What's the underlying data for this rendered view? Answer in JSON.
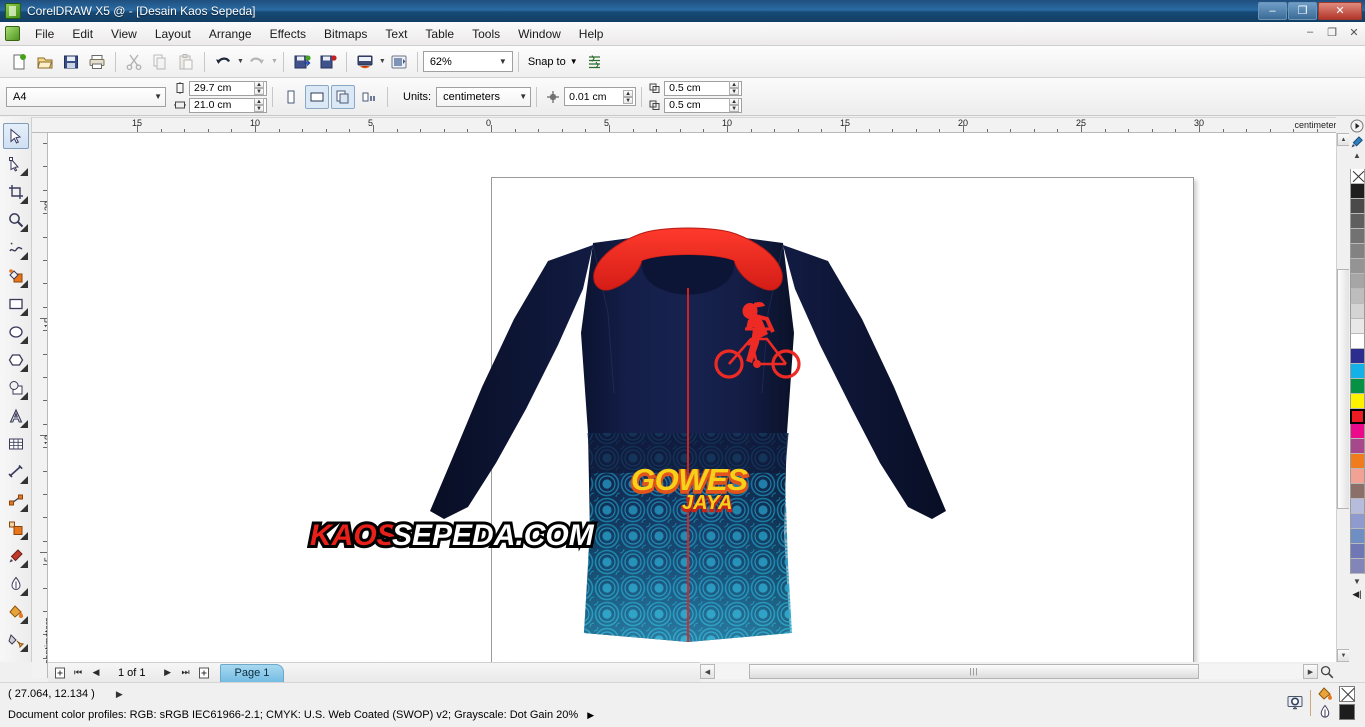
{
  "window": {
    "title": "CorelDRAW X5 @ - [Desain Kaos Sepeda]",
    "app_icon": "coreldraw-icon",
    "minimize": "–",
    "maximize": "❐",
    "close": "✕",
    "mdi_minimize": "–",
    "mdi_restore": "❐",
    "mdi_close": "✕"
  },
  "menubar": {
    "items": [
      {
        "label": "File",
        "accel": "F"
      },
      {
        "label": "Edit",
        "accel": "E"
      },
      {
        "label": "View",
        "accel": "V"
      },
      {
        "label": "Layout",
        "accel": "L"
      },
      {
        "label": "Arrange",
        "accel": "A"
      },
      {
        "label": "Effects",
        "accel": "c"
      },
      {
        "label": "Bitmaps",
        "accel": "B"
      },
      {
        "label": "Text",
        "accel": "x"
      },
      {
        "label": "Table",
        "accel": "T"
      },
      {
        "label": "Tools",
        "accel": "o"
      },
      {
        "label": "Window",
        "accel": "W"
      },
      {
        "label": "Help",
        "accel": "H"
      }
    ]
  },
  "toolbar": {
    "buttons": [
      {
        "name": "new-document-button",
        "tooltip": "New"
      },
      {
        "name": "open-document-button",
        "tooltip": "Open"
      },
      {
        "name": "save-document-button",
        "tooltip": "Save"
      },
      {
        "name": "print-button",
        "tooltip": "Print"
      },
      {
        "name": "cut-button",
        "tooltip": "Cut"
      },
      {
        "name": "copy-button",
        "tooltip": "Copy"
      },
      {
        "name": "paste-button",
        "tooltip": "Paste"
      },
      {
        "name": "undo-button",
        "tooltip": "Undo"
      },
      {
        "name": "redo-button",
        "tooltip": "Redo"
      },
      {
        "name": "import-button",
        "tooltip": "Import"
      },
      {
        "name": "export-button",
        "tooltip": "Export"
      },
      {
        "name": "publish-pdf-button",
        "tooltip": "Publish to PDF"
      },
      {
        "name": "application-launcher-button",
        "tooltip": "Application Launcher"
      }
    ],
    "zoom_level": "62%",
    "snap_to_label": "Snap to",
    "options_tooltip": "Options"
  },
  "propertybar": {
    "paper_type": "A4",
    "page_width": "29.7 cm",
    "page_height": "21.0 cm",
    "orientation_portrait": "portrait-icon",
    "orientation_landscape": "landscape-icon",
    "all_pages_icon": "all-pages-icon",
    "current_page_icon": "current-page-icon",
    "units_label": "Units:",
    "units_value": "centimeters",
    "nudge_offset": "0.01 cm",
    "duplicate_x": "0.5 cm",
    "duplicate_y": "0.5 cm"
  },
  "rulers": {
    "unit_label": "centimeters",
    "horizontal_ticks": [
      "15",
      "10",
      "5",
      "0",
      "5",
      "10",
      "15",
      "20",
      "25",
      "30"
    ],
    "vertical_ticks": [
      "20",
      "15",
      "10",
      "5"
    ]
  },
  "toolbox": {
    "tools": [
      {
        "name": "pick-tool",
        "selected": true
      },
      {
        "name": "shape-tool",
        "selected": false
      },
      {
        "name": "crop-tool",
        "selected": false
      },
      {
        "name": "zoom-tool",
        "selected": false
      },
      {
        "name": "freehand-tool",
        "selected": false
      },
      {
        "name": "smart-fill-tool",
        "selected": false
      },
      {
        "name": "rectangle-tool",
        "selected": false
      },
      {
        "name": "ellipse-tool",
        "selected": false
      },
      {
        "name": "polygon-tool",
        "selected": false
      },
      {
        "name": "basic-shapes-tool",
        "selected": false
      },
      {
        "name": "text-tool",
        "selected": false
      },
      {
        "name": "table-tool",
        "selected": false
      },
      {
        "name": "dimension-tool",
        "selected": false
      },
      {
        "name": "connector-tool",
        "selected": false
      },
      {
        "name": "blend-tool",
        "selected": false
      },
      {
        "name": "color-eyedropper-tool",
        "selected": false
      },
      {
        "name": "outline-tool",
        "selected": false
      },
      {
        "name": "fill-tool",
        "selected": false
      },
      {
        "name": "interactive-fill-tool",
        "selected": false
      }
    ]
  },
  "document": {
    "page_label": "Page 1",
    "page_count": "1 of 1",
    "artwork": {
      "title": "cycling-jersey-design",
      "body_color": "#101a3c",
      "collar_color": "#ee2b24",
      "zipper_color": "#e0251f",
      "pattern_color": "#19b9e8",
      "logo_primary": "GOWES",
      "logo_secondary": "JAYA",
      "logo_primary_fill": "#f7d019",
      "logo_primary_shadow": "#e2541b",
      "logo_secondary_fill": "#f7d019",
      "cyclist_icon": "cyclist-silhouette-icon",
      "cyclist_color": "#ee2a24"
    },
    "watermark": {
      "part1": "KAOS",
      "part2": "SEPEDA.COM",
      "part1_color": "#e8201a",
      "part2_color": "#ffffff"
    }
  },
  "pagenav": {
    "add_page_start": "add-page-start-icon",
    "first": "⏮",
    "prev": "◀",
    "next": "▶",
    "last": "⏭",
    "add_page_end": "add-page-end-icon"
  },
  "statusbar": {
    "coordinates": "( 27.064, 12.134 )",
    "color_profiles": "Document color profiles: RGB: sRGB IEC61966-2.1; CMYK: U.S. Web Coated (SWOP) v2; Grayscale: Dot Gain 20%",
    "fill_label": "fill-bucket-icon",
    "fill_value": "none",
    "outline_label": "outline-pen-icon",
    "outline_color": "#1c1c1c",
    "preview_icon": "color-proof-icon"
  },
  "palette": {
    "scroll_up_icon": "▲",
    "scroll_down_icon": "▼",
    "expand_icon": "◀|",
    "eyedropper_icon": "eyedropper-icon",
    "arrow_icon": "palette-arrow-icon",
    "colors": [
      {
        "hex": "none",
        "name": "No Color",
        "selected": false
      },
      {
        "hex": "#1f1f1f",
        "name": "Black",
        "selected": false
      },
      {
        "hex": "#4a4a4a",
        "name": "90% Black",
        "selected": false
      },
      {
        "hex": "#5f5f5f",
        "name": "80% Black",
        "selected": false
      },
      {
        "hex": "#727272",
        "name": "70% Black",
        "selected": false
      },
      {
        "hex": "#828282",
        "name": "60% Black",
        "selected": false
      },
      {
        "hex": "#949494",
        "name": "50% Black",
        "selected": false
      },
      {
        "hex": "#a6a6a6",
        "name": "40% Black",
        "selected": false
      },
      {
        "hex": "#bdbdbd",
        "name": "30% Black",
        "selected": false
      },
      {
        "hex": "#d4d4d4",
        "name": "20% Black",
        "selected": false
      },
      {
        "hex": "#e8e8e8",
        "name": "10% Black",
        "selected": false
      },
      {
        "hex": "#ffffff",
        "name": "White",
        "selected": false
      },
      {
        "hex": "#2b2d8f",
        "name": "Blue",
        "selected": false
      },
      {
        "hex": "#12b2e8",
        "name": "Cyan",
        "selected": false
      },
      {
        "hex": "#069145",
        "name": "Green",
        "selected": false
      },
      {
        "hex": "#fff200",
        "name": "Yellow",
        "selected": false
      },
      {
        "hex": "#ed1c24",
        "name": "Red",
        "selected": true
      },
      {
        "hex": "#ec0a8c",
        "name": "Magenta",
        "selected": false
      },
      {
        "hex": "#a8488c",
        "name": "Purple",
        "selected": false
      },
      {
        "hex": "#f07c1e",
        "name": "Orange",
        "selected": false
      },
      {
        "hex": "#f2a294",
        "name": "Salmon Pink",
        "selected": false
      },
      {
        "hex": "#8a7069",
        "name": "Brown",
        "selected": false
      },
      {
        "hex": "#b6bcdc",
        "name": "Pale Blue",
        "selected": false
      },
      {
        "hex": "#8f9bce",
        "name": "Light Blue Violet",
        "selected": false
      },
      {
        "hex": "#6f8fc4",
        "name": "Sky Blue",
        "selected": false
      },
      {
        "hex": "#6f78b4",
        "name": "Blue Violet",
        "selected": false
      },
      {
        "hex": "#8185b8",
        "name": "Periwinkle",
        "selected": false
      }
    ]
  }
}
